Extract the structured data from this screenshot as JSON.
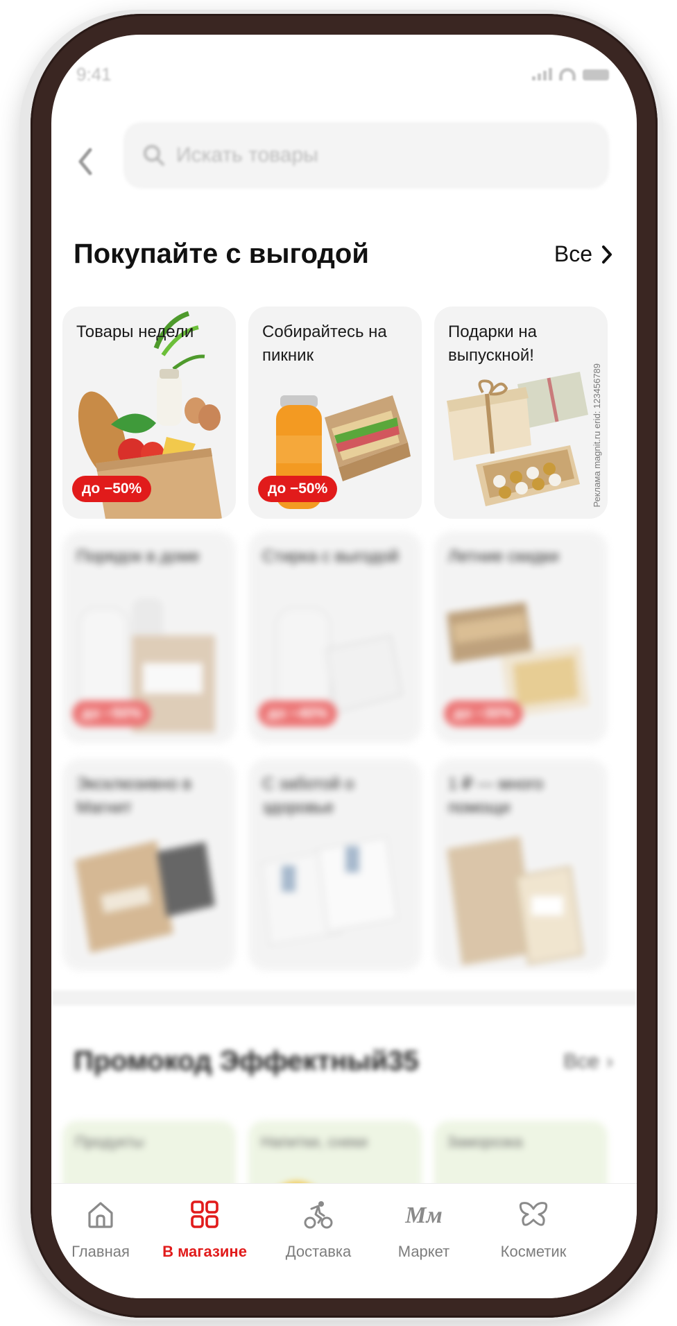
{
  "status_bar": {
    "time": "9:41"
  },
  "search": {
    "placeholder": "Искать товары"
  },
  "section": {
    "title": "Покупайте с выгодой",
    "all_label": "Все"
  },
  "tiles": [
    {
      "label": "Товары недели",
      "badge": "до −50%"
    },
    {
      "label": "Собирайтесь на пикник",
      "badge": "до −50%"
    },
    {
      "label": "Подарки на выпускной!",
      "ad_mark": "Реклама magnit.ru erid: 123456789"
    },
    {
      "label": "Порядок в доме",
      "badge": "до −50%"
    },
    {
      "label": "Стирка с выгодой",
      "badge": "до −40%"
    },
    {
      "label": "Летние скидки",
      "badge": "до −30%"
    },
    {
      "label": "Эксклюзивно в Магнит"
    },
    {
      "label": "С заботой о здоровье"
    },
    {
      "label": "1 ₽ — много помощи"
    }
  ],
  "promo": {
    "title": "Промокод Эффектный35",
    "all_label": "Все",
    "categories": [
      "Продукты",
      "Напитки, снеки",
      "Заморозка"
    ]
  },
  "tabbar": {
    "items": [
      {
        "label": "Главная",
        "icon": "home-icon"
      },
      {
        "label": "В магазине",
        "icon": "store-grid-icon",
        "active": true
      },
      {
        "label": "Доставка",
        "icon": "delivery-bike-icon"
      },
      {
        "label": "Маркет",
        "icon": "market-logo-icon"
      },
      {
        "label": "Косметик",
        "icon": "butterfly-icon"
      }
    ]
  },
  "colors": {
    "accent": "#e11b1b",
    "frame": "#3a2622",
    "tile_bg": "#f3f3f3"
  }
}
